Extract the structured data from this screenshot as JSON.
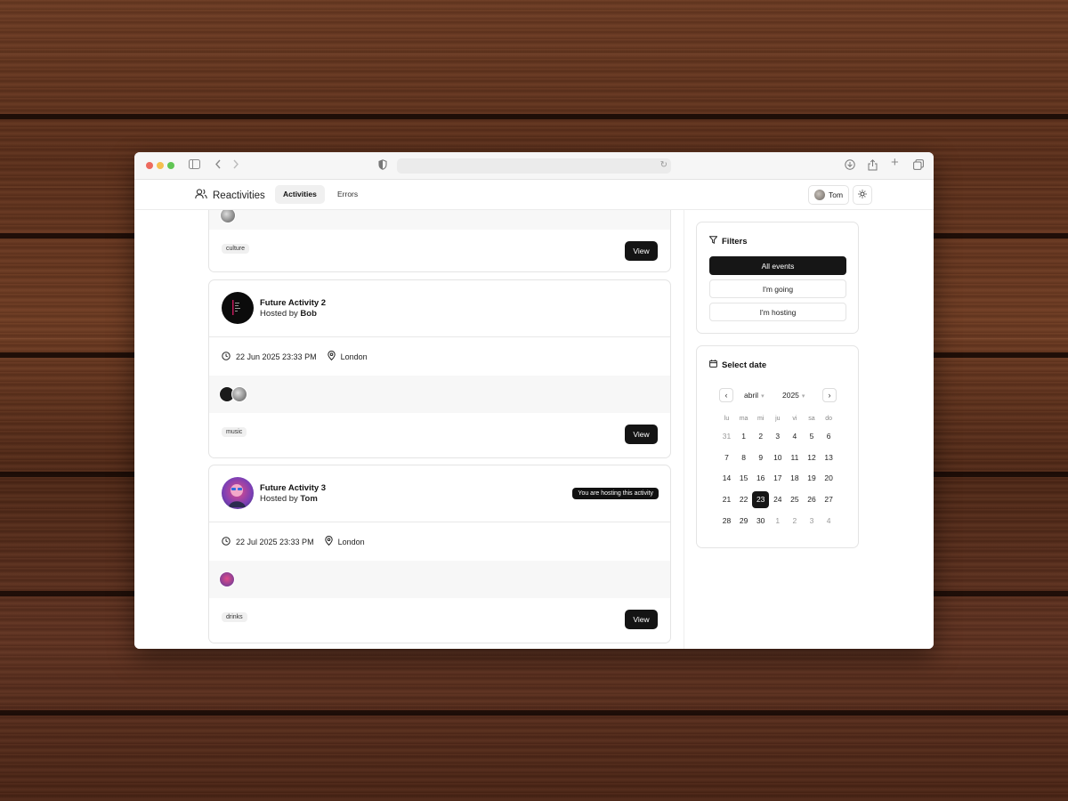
{
  "app": {
    "brand": "Reactivities",
    "nav": [
      {
        "label": "Activities",
        "active": true
      },
      {
        "label": "Errors",
        "active": false
      }
    ],
    "user": {
      "name": "Tom"
    }
  },
  "activities": [
    {
      "title": "",
      "tag": "culture",
      "view_label": "View"
    },
    {
      "title": "Future Activity 2",
      "hosted_by_prefix": "Hosted by",
      "host": "Bob",
      "date": "22 Jun 2025 23:33 PM",
      "venue": "London",
      "tag": "music",
      "view_label": "View"
    },
    {
      "title": "Future Activity 3",
      "hosted_by_prefix": "Hosted by",
      "host": "Tom",
      "badge": "You are hosting this activity",
      "date": "22 Jul 2025 23:33 PM",
      "venue": "London",
      "tag": "drinks",
      "view_label": "View"
    }
  ],
  "filters": {
    "title": "Filters",
    "options": [
      "All events",
      "I'm going",
      "I'm hosting"
    ],
    "selected": "All events"
  },
  "calendar": {
    "title": "Select date",
    "month": "abril",
    "year": "2025",
    "weekdays": [
      "lu",
      "ma",
      "mi",
      "ju",
      "vi",
      "sa",
      "do"
    ],
    "weeks": [
      [
        "31",
        "1",
        "2",
        "3",
        "4",
        "5",
        "6"
      ],
      [
        "7",
        "8",
        "9",
        "10",
        "11",
        "12",
        "13"
      ],
      [
        "14",
        "15",
        "16",
        "17",
        "18",
        "19",
        "20"
      ],
      [
        "21",
        "22",
        "23",
        "24",
        "25",
        "26",
        "27"
      ],
      [
        "28",
        "29",
        "30",
        "1",
        "2",
        "3",
        "4"
      ]
    ],
    "selected_day": "23"
  },
  "colors": {
    "primary": "#161616",
    "border": "#e4e4e4",
    "muted_bg": "#f7f7f7"
  }
}
